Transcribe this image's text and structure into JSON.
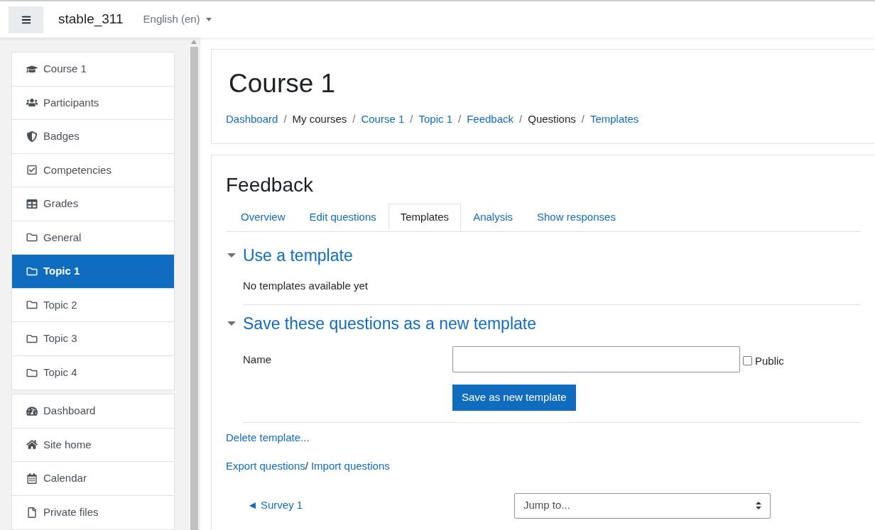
{
  "navbar": {
    "site_name": "stable_311",
    "language": "English (en)"
  },
  "sidebar": {
    "groups": [
      {
        "items": [
          {
            "label": "Course 1",
            "selected": false
          },
          {
            "label": "Participants",
            "selected": false
          },
          {
            "label": "Badges",
            "selected": false
          },
          {
            "label": "Competencies",
            "selected": false
          },
          {
            "label": "Grades",
            "selected": false
          },
          {
            "label": "General",
            "selected": false
          },
          {
            "label": "Topic 1",
            "selected": true
          },
          {
            "label": "Topic 2",
            "selected": false
          },
          {
            "label": "Topic 3",
            "selected": false
          },
          {
            "label": "Topic 4",
            "selected": false
          }
        ]
      },
      {
        "items": [
          {
            "label": "Dashboard",
            "selected": false
          },
          {
            "label": "Site home",
            "selected": false
          },
          {
            "label": "Calendar",
            "selected": false
          },
          {
            "label": "Private files",
            "selected": false
          }
        ]
      }
    ]
  },
  "header": {
    "title": "Course 1",
    "breadcrumbs": [
      {
        "label": "Dashboard",
        "link": true
      },
      {
        "label": "My courses",
        "link": false
      },
      {
        "label": "Course 1",
        "link": true
      },
      {
        "label": "Topic 1",
        "link": true
      },
      {
        "label": "Feedback",
        "link": true
      },
      {
        "label": "Questions",
        "link": false
      },
      {
        "label": "Templates",
        "link": true
      }
    ],
    "separator": "/"
  },
  "main": {
    "title": "Feedback",
    "tabs": [
      {
        "label": "Overview",
        "selected": false
      },
      {
        "label": "Edit questions",
        "selected": false
      },
      {
        "label": "Templates",
        "selected": true
      },
      {
        "label": "Analysis",
        "selected": false
      },
      {
        "label": "Show responses",
        "selected": false
      }
    ],
    "use_template": {
      "heading": "Use a template",
      "expanded": true,
      "message": "No templates available yet"
    },
    "save_template": {
      "heading": "Save these questions as a new template",
      "expanded": true,
      "name_label": "Name",
      "public_label": "Public",
      "public_checked": false,
      "button": "Save as new template"
    },
    "delete_link": "Delete template...",
    "export_link": "Export questions",
    "export_separator": "/",
    "import_link": "Import questions",
    "prev_link": "◄ Survey 1",
    "jump_select": "Jump to..."
  }
}
